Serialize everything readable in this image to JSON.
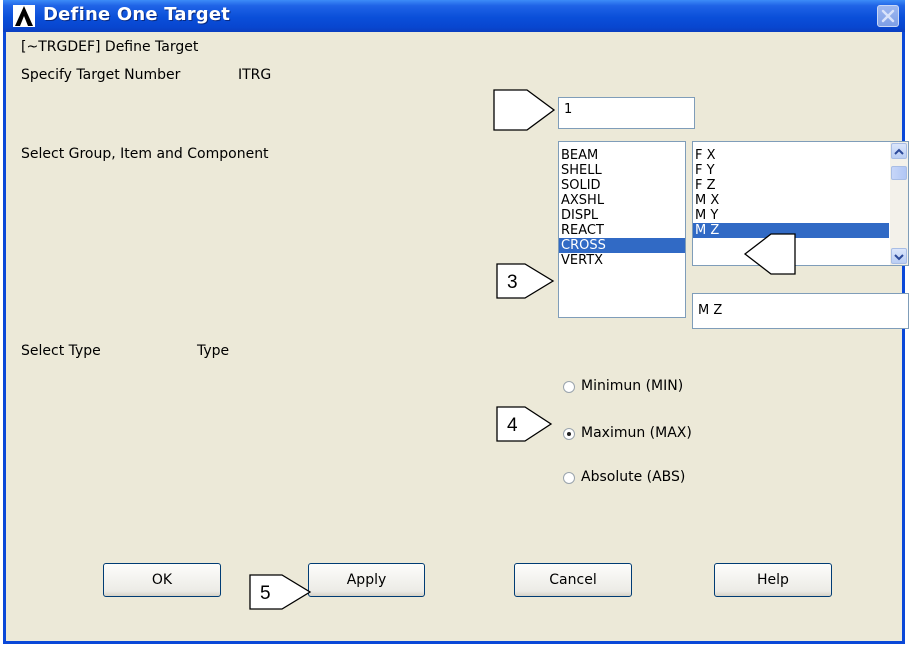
{
  "window": {
    "title": "Define One Target"
  },
  "command": "[~TRGDEF] Define Target",
  "target_number": {
    "label": "Specify Target Number",
    "param": "ITRG",
    "value": "1"
  },
  "group_select": {
    "label": "Select Group, Item and Component",
    "groups": [
      "BEAM",
      "SHELL",
      "SOLID",
      "AXSHL",
      "DISPL",
      "REACT",
      "CROSS",
      "VERTX"
    ],
    "selected_group": "CROSS",
    "components": [
      "F X",
      "F Y",
      "F Z",
      "M X",
      "M Y",
      "M Z"
    ],
    "selected_component": "M Z",
    "component_value": "M Z"
  },
  "type_select": {
    "label": "Select Type",
    "param": "Type",
    "options": [
      "Minimun  (MIN)",
      "Maximun  (MAX)",
      "Absolute (ABS)"
    ],
    "selected": "Maximun  (MAX)"
  },
  "buttons": {
    "ok": "OK",
    "apply": "Apply",
    "cancel": "Cancel",
    "help": "Help"
  },
  "callouts": {
    "step3": "3",
    "step4": "4",
    "step5": "5"
  },
  "colors": {
    "titlebar": "#0a4fd9",
    "dialog_bg": "#ece9d8",
    "selection": "#316ac5"
  }
}
